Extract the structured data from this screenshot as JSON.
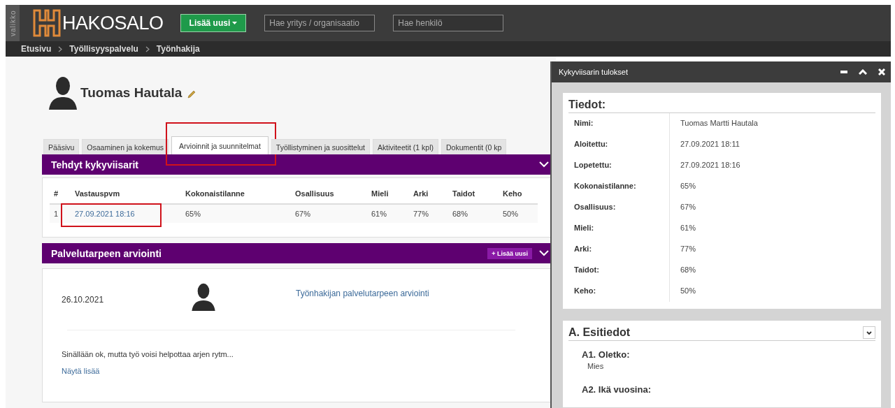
{
  "sidebar_toggle": {
    "label": "valikko"
  },
  "logo": {
    "text": "HAKOSALO"
  },
  "add_button": {
    "label": "Lisää uusi"
  },
  "search_fields": [
    {
      "placeholder": "Hae yritys / organisaatio"
    },
    {
      "placeholder": "Hae henkilö"
    }
  ],
  "breadcrumb": [
    "Etusivu",
    "Työllisyyspalvelu",
    "Työnhakija"
  ],
  "profile": {
    "name": "Tuomas Hautala"
  },
  "tabs": [
    {
      "label": "Pääsivu",
      "selected": false,
      "highlighted": false
    },
    {
      "label": "Osaaminen ja kokemus",
      "selected": false,
      "highlighted": false
    },
    {
      "label": "Arvioinnit ja suunnitelmat",
      "selected": true,
      "highlighted": true
    },
    {
      "label": "Työllistyminen ja suosittelut",
      "selected": false,
      "highlighted": false
    },
    {
      "label": "Aktiviteetit (1 kpl)",
      "selected": false,
      "highlighted": false
    },
    {
      "label": "Dokumentit (0 kp",
      "selected": false,
      "highlighted": false
    }
  ],
  "panels": [
    {
      "kind": "table",
      "title": "Tehdyt kykyviisarit",
      "expanded": true,
      "columns": [
        {
          "label": "#",
          "kind": "text"
        },
        {
          "label": "Vastauspvm",
          "kind": "link"
        },
        {
          "label": "Kokonaistilanne",
          "kind": "text"
        },
        {
          "label": "Osallisuus",
          "kind": "text"
        },
        {
          "label": "Mieli",
          "kind": "text"
        },
        {
          "label": "Arki",
          "kind": "text"
        },
        {
          "label": "Taidot",
          "kind": "text"
        },
        {
          "label": "Keho",
          "kind": "text"
        }
      ],
      "rows": [
        {
          "cells": [
            "1",
            "27.09.2021 18:16",
            "65%",
            "67%",
            "61%",
            "77%",
            "68%",
            "50%"
          ],
          "highlighted": true
        }
      ]
    },
    {
      "kind": "entries",
      "title": "Palvelutarpeen arviointi",
      "add_button": "+ Lisää uusi",
      "expanded": true,
      "entries": [
        {
          "date": "26.10.2021",
          "link": "Työnhakijan palvelutarpeen arviointi",
          "summary": "Sinällään ok, mutta työ voisi helpottaa arjen rytm...",
          "more_link": "Näytä lisää"
        }
      ]
    }
  ],
  "dialog": {
    "title": "Kykyviisarin tulokset",
    "sections": [
      {
        "kind": "details",
        "title": "Tiedot:",
        "rows": [
          {
            "label": "Nimi:",
            "value": "Tuomas Martti Hautala"
          },
          {
            "label": "Aloitettu:",
            "value": "27.09.2021 18:11"
          },
          {
            "label": "Lopetettu:",
            "value": "27.09.2021 18:16"
          },
          {
            "label": "Kokonaistilanne:",
            "value": "65%"
          },
          {
            "label": "Osallisuus:",
            "value": "67%"
          },
          {
            "label": "Mieli:",
            "value": "61%"
          },
          {
            "label": "Arki:",
            "value": "77%"
          },
          {
            "label": "Taidot:",
            "value": "68%"
          },
          {
            "label": "Keho:",
            "value": "50%"
          }
        ]
      },
      {
        "kind": "questions",
        "title": "A. Esitiedot",
        "expanded": true,
        "questions": [
          {
            "question": "A1. Oletko:",
            "answer": "Mies"
          },
          {
            "question": "A2. Ikä vuosina:"
          }
        ]
      }
    ]
  }
}
